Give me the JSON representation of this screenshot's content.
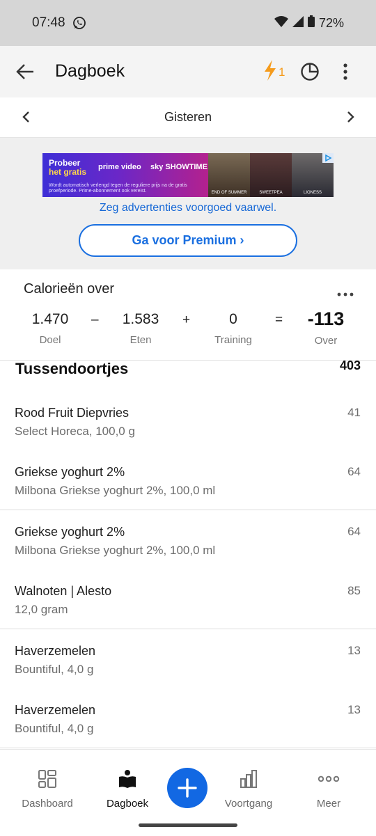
{
  "status_bar": {
    "time": "07:48",
    "battery": "72%"
  },
  "app_bar": {
    "title": "Dagboek",
    "streak_count": "1"
  },
  "date_nav": {
    "label": "Gisteren"
  },
  "ad": {
    "banner_line1": "Probeer",
    "banner_line2": "het gratis",
    "brand_prime": "prime video",
    "brand_sky": "sky SHOWTIME",
    "fine_print": "Wordt automatisch verlengd tegen de reguliere prijs na de gratis proefperiode. Prime-abonnement ook vereist.",
    "poster1": "END OF SUMMER",
    "poster2": "SWEETPEA",
    "poster3": "LIONESS",
    "remove_ads_text": "Zeg advertenties voorgoed vaarwel.",
    "premium_button": "Ga voor Premium ›"
  },
  "calories": {
    "title": "Calorieën over",
    "goal_value": "1.470",
    "goal_label": "Doel",
    "op_minus": "–",
    "food_value": "1.583",
    "food_label": "Eten",
    "op_plus": "+",
    "exercise_value": "0",
    "exercise_label": "Training",
    "op_equals": "=",
    "remaining_value": "-113",
    "remaining_label": "Over"
  },
  "meal_section": {
    "title": "Tussendoortjes",
    "total": "403"
  },
  "food_items": [
    {
      "name": "Rood Fruit Diepvries",
      "desc": "Select Horeca, 100,0 g",
      "cal": "41"
    },
    {
      "name": "Griekse yoghurt 2%",
      "desc": "Milbona Griekse yoghurt 2%, 100,0 ml",
      "cal": "64"
    },
    {
      "name": "Griekse yoghurt 2%",
      "desc": "Milbona Griekse yoghurt 2%, 100,0 ml",
      "cal": "64"
    },
    {
      "name": "Walnoten | Alesto",
      "desc": "12,0 gram",
      "cal": "85"
    },
    {
      "name": "Haverzemelen",
      "desc": "Bountiful, 4,0 g",
      "cal": "13"
    },
    {
      "name": "Haverzemelen",
      "desc": "Bountiful, 4,0 g",
      "cal": "13"
    }
  ],
  "bottom_nav": {
    "dashboard": "Dashboard",
    "diary": "Dagboek",
    "progress": "Voortgang",
    "more": "Meer"
  },
  "colors": {
    "accent": "#1268e3",
    "streak": "#f59b1c",
    "link": "#1668d6"
  }
}
